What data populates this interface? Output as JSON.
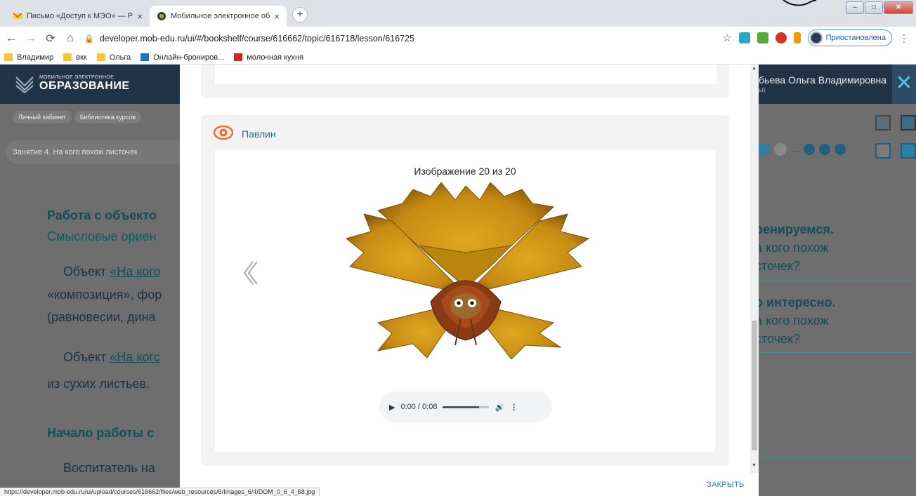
{
  "browser": {
    "tabs": [
      {
        "title": "Письмо «Доступ к МЭО» — Роз",
        "active": false
      },
      {
        "title": "Мобильное электронное обра:",
        "active": true
      }
    ],
    "new_tab": "+",
    "tab_close": "×",
    "url": "developer.mob-edu.ru/ui/#/bookshelf/course/616662/topic/616718/lesson/616725",
    "profile_status": "Приостановлена",
    "bookmarks": [
      "Владимир",
      "вкк",
      "Ольга",
      "Онлайн-брониров...",
      "молочная кухня"
    ],
    "status_url": "https://developer.mob-edu.ru/ui/upload/courses/616662/files/web_resources/6/Images_6/4/DOM_0_6_4_58.jpg"
  },
  "app": {
    "logo_small": "МОБИЛЬНОЕ ЭЛЕКТРОННОЕ",
    "logo_big": "ОБРАЗОВАНИЕ",
    "user_name": "бьева Ольга Владимировна",
    "user_sub": "ы)",
    "breadcrumbs": [
      "Личный кабинет",
      "Библиотека курсов"
    ],
    "lesson_title": "Занятие 4. На кого похож листочек",
    "content": {
      "heading1": "Работа с объекто",
      "subheading1": "Смысловые ориен",
      "p1_prefix": "Объект ",
      "p1_link": "«На кого",
      "p1_line2": "«композиция», фор",
      "p1_line3": "(равновесии, дина",
      "p2_prefix": "Объект ",
      "p2_link": "«На когс",
      "p2_line2": "из сухих листьев.",
      "heading2": "Начало работы с",
      "p3": "Воспитатель на"
    },
    "side_links": [
      {
        "title": "ренируемся.",
        "line2": "а кого похож",
        "line3": "сточек?"
      },
      {
        "title": "о интересно.",
        "line2": "а кого похож",
        "line3": "сточек?"
      }
    ]
  },
  "modal": {
    "card_title": "Павлин",
    "counter": "Изображение 20 из 20",
    "audio": {
      "time": "0:00 / 0:08",
      "volume_fraction": 0.78
    },
    "close_label": "ЗАКРЫТЬ"
  }
}
